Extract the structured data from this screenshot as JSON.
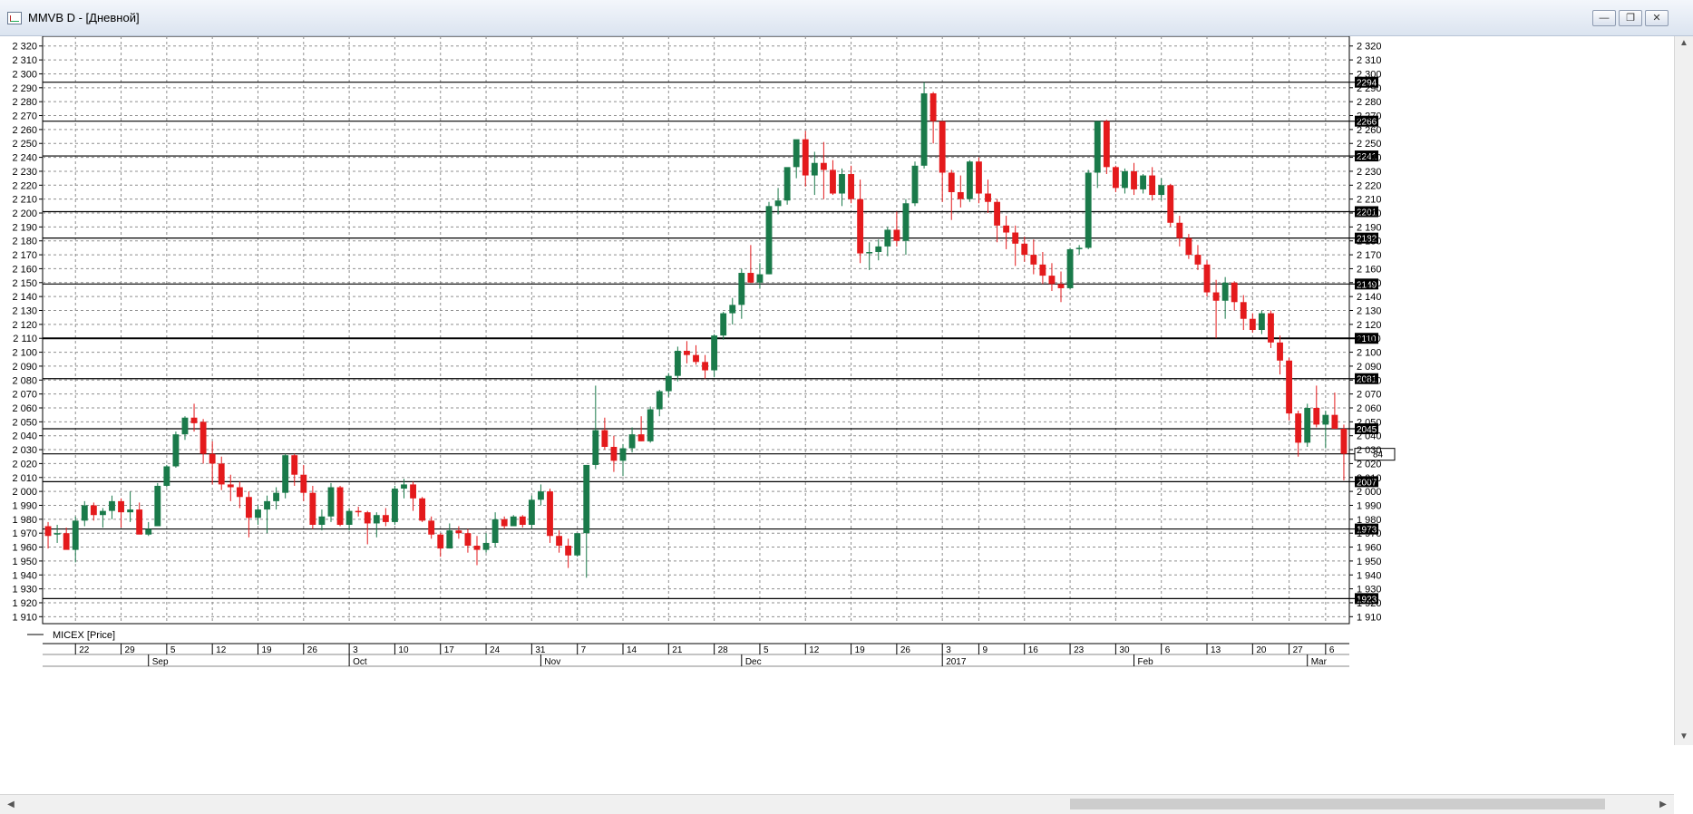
{
  "window": {
    "title": "MMVB D - [Дневной]",
    "buttons": [
      "minimize",
      "restore",
      "close"
    ]
  },
  "legend": {
    "series_label": "MICEX [Price]"
  },
  "last_price_tag": "84",
  "colors": {
    "up": "#1a7a4a",
    "down": "#e41a1c",
    "grid": "#8f8f8f",
    "level_line": "#000000"
  },
  "chart_data": {
    "type": "candlestick",
    "title": "MMVB D - [Дневной]",
    "series_name": "MICEX [Price]",
    "ylim": [
      1905,
      2327
    ],
    "y_ticks": [
      1910,
      1920,
      1930,
      1940,
      1950,
      1960,
      1970,
      1980,
      1990,
      2000,
      2010,
      2020,
      2030,
      2040,
      2050,
      2060,
      2070,
      2080,
      2090,
      2100,
      2110,
      2120,
      2130,
      2140,
      2150,
      2160,
      2170,
      2180,
      2190,
      2200,
      2210,
      2220,
      2230,
      2240,
      2250,
      2260,
      2270,
      2280,
      2290,
      2300,
      2310,
      2320
    ],
    "x_day_labels": [
      {
        "label": "22",
        "i": 3
      },
      {
        "label": "29",
        "i": 8
      },
      {
        "label": "5",
        "i": 13
      },
      {
        "label": "12",
        "i": 18
      },
      {
        "label": "19",
        "i": 23
      },
      {
        "label": "26",
        "i": 28
      },
      {
        "label": "3",
        "i": 33
      },
      {
        "label": "10",
        "i": 38
      },
      {
        "label": "17",
        "i": 43
      },
      {
        "label": "24",
        "i": 48
      },
      {
        "label": "31",
        "i": 53
      },
      {
        "label": "7",
        "i": 58
      },
      {
        "label": "14",
        "i": 63
      },
      {
        "label": "21",
        "i": 68
      },
      {
        "label": "28",
        "i": 73
      },
      {
        "label": "5",
        "i": 78
      },
      {
        "label": "12",
        "i": 83
      },
      {
        "label": "19",
        "i": 88
      },
      {
        "label": "26",
        "i": 93
      },
      {
        "label": "3",
        "i": 98
      },
      {
        "label": "9",
        "i": 102
      },
      {
        "label": "16",
        "i": 107
      },
      {
        "label": "23",
        "i": 112
      },
      {
        "label": "30",
        "i": 117
      },
      {
        "label": "6",
        "i": 122
      },
      {
        "label": "13",
        "i": 127
      },
      {
        "label": "20",
        "i": 132
      },
      {
        "label": "27",
        "i": 136
      },
      {
        "label": "6",
        "i": 140
      }
    ],
    "x_month_labels": [
      {
        "label": "Sep",
        "i": 11
      },
      {
        "label": "Oct",
        "i": 33
      },
      {
        "label": "Nov",
        "i": 54
      },
      {
        "label": "Dec",
        "i": 76
      },
      {
        "label": "2017",
        "i": 98
      },
      {
        "label": "Feb",
        "i": 119
      },
      {
        "label": "Mar",
        "i": 138
      }
    ],
    "horizontal_levels": [
      2294,
      2266,
      2241,
      2201,
      2182,
      2149,
      2110,
      2081,
      2045,
      2027,
      2007,
      1973,
      1923
    ],
    "ohlc": [
      [
        1975,
        1978,
        1959,
        1968
      ],
      [
        1969,
        1976,
        1963,
        1970
      ],
      [
        1970,
        1974,
        1960,
        1958
      ],
      [
        1958,
        1982,
        1949,
        1979
      ],
      [
        1979,
        1993,
        1975,
        1990
      ],
      [
        1990,
        1992,
        1979,
        1983
      ],
      [
        1983,
        1988,
        1974,
        1986
      ],
      [
        1986,
        1997,
        1980,
        1993
      ],
      [
        1993,
        1995,
        1974,
        1985
      ],
      [
        1985,
        2000,
        1978,
        1987
      ],
      [
        1987,
        1992,
        1971,
        1969
      ],
      [
        1969,
        1978,
        1968,
        1973
      ],
      [
        1975,
        2006,
        1975,
        2004
      ],
      [
        2004,
        2019,
        2003,
        2018
      ],
      [
        2018,
        2043,
        2017,
        2041
      ],
      [
        2041,
        2054,
        2037,
        2053
      ],
      [
        2053,
        2063,
        2043,
        2049
      ],
      [
        2050,
        2052,
        2020,
        2027
      ],
      [
        2027,
        2036,
        2005,
        2020
      ],
      [
        2020,
        2025,
        2001,
        2005
      ],
      [
        2005,
        2012,
        1993,
        2003
      ],
      [
        2003,
        2007,
        1988,
        1996
      ],
      [
        1996,
        2000,
        1967,
        1981
      ],
      [
        1981,
        1990,
        1976,
        1987
      ],
      [
        1987,
        1997,
        1970,
        1993
      ],
      [
        1993,
        2003,
        1987,
        1999
      ],
      [
        1999,
        2027,
        1995,
        2026
      ],
      [
        2026,
        2027,
        2004,
        2012
      ],
      [
        2012,
        2019,
        1993,
        1999
      ],
      [
        1999,
        2004,
        1973,
        1976
      ],
      [
        1976,
        1987,
        1972,
        1982
      ],
      [
        1982,
        2006,
        1978,
        2003
      ],
      [
        2003,
        2004,
        1975,
        1976
      ],
      [
        1976,
        1988,
        1972,
        1986
      ],
      [
        1986,
        1989,
        1982,
        1985
      ],
      [
        1985,
        1986,
        1962,
        1977
      ],
      [
        1977,
        1985,
        1967,
        1983
      ],
      [
        1983,
        1988,
        1975,
        1978
      ],
      [
        1978,
        2004,
        1976,
        2002
      ],
      [
        2002,
        2009,
        1995,
        2005
      ],
      [
        2005,
        2007,
        1986,
        1995
      ],
      [
        1995,
        1996,
        1978,
        1979
      ],
      [
        1979,
        1982,
        1966,
        1969
      ],
      [
        1969,
        1970,
        1953,
        1959
      ],
      [
        1959,
        1977,
        1959,
        1972
      ],
      [
        1972,
        1975,
        1966,
        1970
      ],
      [
        1970,
        1973,
        1956,
        1961
      ],
      [
        1961,
        1968,
        1947,
        1958
      ],
      [
        1958,
        1970,
        1956,
        1963
      ],
      [
        1963,
        1985,
        1960,
        1980
      ],
      [
        1980,
        1982,
        1973,
        1975
      ],
      [
        1975,
        1983,
        1975,
        1982
      ],
      [
        1982,
        1983,
        1974,
        1976
      ],
      [
        1976,
        1997,
        1973,
        1994
      ],
      [
        1994,
        2005,
        1990,
        2000
      ],
      [
        2000,
        2002,
        1963,
        1968
      ],
      [
        1968,
        1972,
        1956,
        1961
      ],
      [
        1961,
        1966,
        1945,
        1954
      ],
      [
        1954,
        1970,
        1953,
        1970
      ],
      [
        1970,
        2019,
        1938,
        2019
      ],
      [
        2019,
        2076,
        2016,
        2044
      ],
      [
        2044,
        2053,
        2030,
        2032
      ],
      [
        2032,
        2040,
        2014,
        2022
      ],
      [
        2022,
        2034,
        2011,
        2031
      ],
      [
        2031,
        2046,
        2028,
        2041
      ],
      [
        2041,
        2054,
        2036,
        2036
      ],
      [
        2036,
        2061,
        2035,
        2059
      ],
      [
        2059,
        2073,
        2054,
        2072
      ],
      [
        2072,
        2085,
        2068,
        2083
      ],
      [
        2083,
        2104,
        2079,
        2101
      ],
      [
        2101,
        2108,
        2092,
        2098
      ],
      [
        2098,
        2105,
        2091,
        2093
      ],
      [
        2093,
        2098,
        2081,
        2087
      ],
      [
        2087,
        2113,
        2082,
        2112
      ],
      [
        2112,
        2129,
        2109,
        2128
      ],
      [
        2128,
        2139,
        2120,
        2134
      ],
      [
        2134,
        2160,
        2124,
        2157
      ],
      [
        2157,
        2177,
        2150,
        2150
      ],
      [
        2150,
        2164,
        2146,
        2156
      ],
      [
        2156,
        2208,
        2156,
        2205
      ],
      [
        2205,
        2218,
        2199,
        2209
      ],
      [
        2209,
        2229,
        2206,
        2233
      ],
      [
        2233,
        2249,
        2225,
        2253
      ],
      [
        2253,
        2259,
        2219,
        2227
      ],
      [
        2227,
        2244,
        2213,
        2236
      ],
      [
        2236,
        2251,
        2210,
        2231
      ],
      [
        2231,
        2238,
        2213,
        2214
      ],
      [
        2214,
        2232,
        2205,
        2228
      ],
      [
        2228,
        2234,
        2207,
        2210
      ],
      [
        2210,
        2224,
        2164,
        2171
      ],
      [
        2171,
        2179,
        2159,
        2172
      ],
      [
        2172,
        2181,
        2166,
        2176
      ],
      [
        2176,
        2190,
        2169,
        2188
      ],
      [
        2188,
        2201,
        2176,
        2180
      ],
      [
        2180,
        2210,
        2170,
        2207
      ],
      [
        2207,
        2237,
        2205,
        2234
      ],
      [
        2234,
        2294,
        2232,
        2286
      ],
      [
        2286,
        2287,
        2250,
        2266
      ],
      [
        2266,
        2266,
        2208,
        2229
      ],
      [
        2229,
        2231,
        2195,
        2215
      ],
      [
        2215,
        2227,
        2204,
        2210
      ],
      [
        2210,
        2238,
        2208,
        2237
      ],
      [
        2237,
        2240,
        2207,
        2214
      ],
      [
        2214,
        2224,
        2200,
        2208
      ],
      [
        2208,
        2210,
        2179,
        2191
      ],
      [
        2191,
        2198,
        2174,
        2186
      ],
      [
        2186,
        2191,
        2162,
        2178
      ],
      [
        2178,
        2183,
        2165,
        2170
      ],
      [
        2170,
        2181,
        2156,
        2163
      ],
      [
        2163,
        2172,
        2149,
        2155
      ],
      [
        2155,
        2164,
        2144,
        2149
      ],
      [
        2149,
        2158,
        2136,
        2146
      ],
      [
        2146,
        2175,
        2145,
        2174
      ],
      [
        2174,
        2177,
        2170,
        2175
      ],
      [
        2175,
        2231,
        2174,
        2229
      ],
      [
        2229,
        2265,
        2218,
        2266
      ],
      [
        2266,
        2267,
        2228,
        2233
      ],
      [
        2233,
        2234,
        2215,
        2218
      ],
      [
        2218,
        2232,
        2214,
        2230
      ],
      [
        2230,
        2236,
        2213,
        2217
      ],
      [
        2217,
        2228,
        2214,
        2227
      ],
      [
        2227,
        2233,
        2209,
        2213
      ],
      [
        2213,
        2225,
        2209,
        2220
      ],
      [
        2220,
        2221,
        2190,
        2193
      ],
      [
        2193,
        2198,
        2176,
        2182
      ],
      [
        2182,
        2185,
        2167,
        2170
      ],
      [
        2170,
        2177,
        2159,
        2163
      ],
      [
        2163,
        2166,
        2140,
        2143
      ],
      [
        2143,
        2152,
        2110,
        2137
      ],
      [
        2137,
        2154,
        2124,
        2150
      ],
      [
        2150,
        2151,
        2130,
        2136
      ],
      [
        2136,
        2141,
        2116,
        2124
      ],
      [
        2124,
        2128,
        2114,
        2116
      ],
      [
        2116,
        2130,
        2113,
        2128
      ],
      [
        2128,
        2130,
        2103,
        2107
      ],
      [
        2107,
        2112,
        2084,
        2094
      ],
      [
        2094,
        2096,
        2051,
        2056
      ],
      [
        2056,
        2058,
        2025,
        2035
      ],
      [
        2035,
        2063,
        2032,
        2060
      ],
      [
        2060,
        2076,
        2046,
        2048
      ],
      [
        2048,
        2058,
        2031,
        2055
      ],
      [
        2055,
        2071,
        2046,
        2045
      ],
      [
        2045,
        2048,
        2008,
        2027
      ]
    ]
  }
}
